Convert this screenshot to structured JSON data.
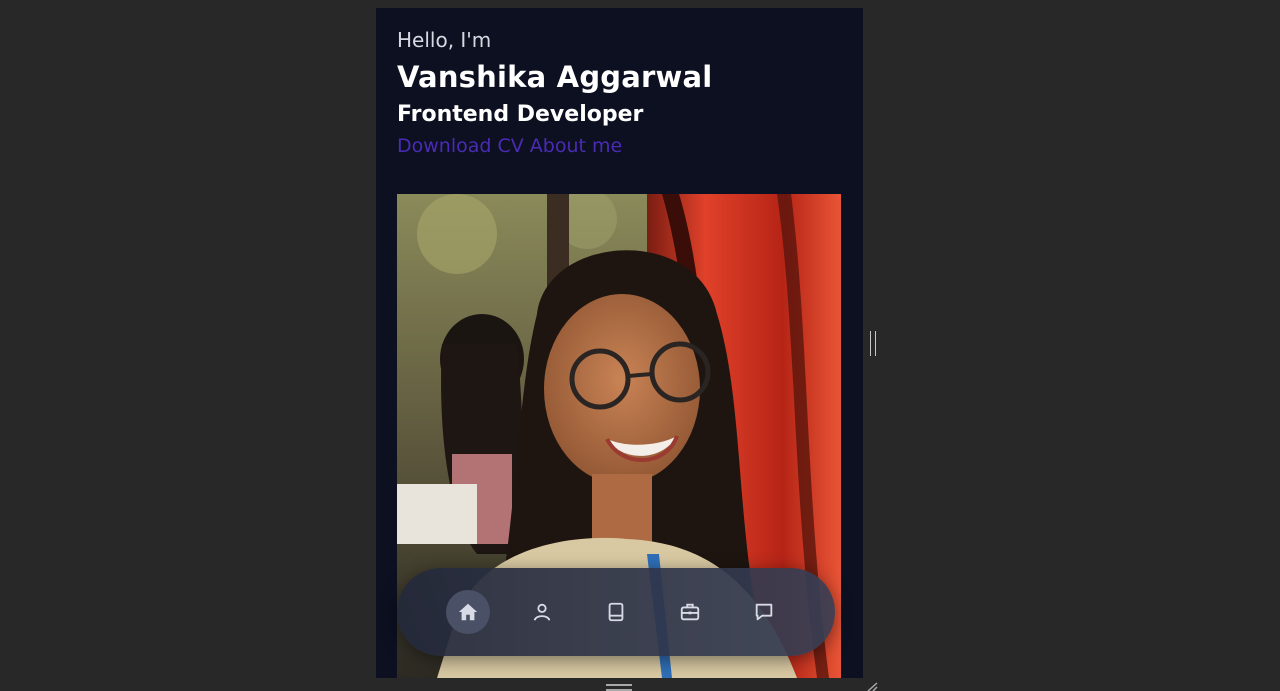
{
  "hero": {
    "greeting": "Hello, I'm",
    "name": "Vanshika Aggarwal",
    "role": "Frontend Developer",
    "download_label": "Download CV",
    "about_label": "About me",
    "link_color": "#4a2bb5"
  },
  "dock": {
    "items": [
      {
        "icon": "home-icon",
        "active": true
      },
      {
        "icon": "user-icon",
        "active": false
      },
      {
        "icon": "book-icon",
        "active": false
      },
      {
        "icon": "briefcase-icon",
        "active": false
      },
      {
        "icon": "message-icon",
        "active": false
      }
    ]
  },
  "colors": {
    "page_bg": "#282828",
    "panel_bg": "#0c1020",
    "accent": "#4a2bb5"
  }
}
